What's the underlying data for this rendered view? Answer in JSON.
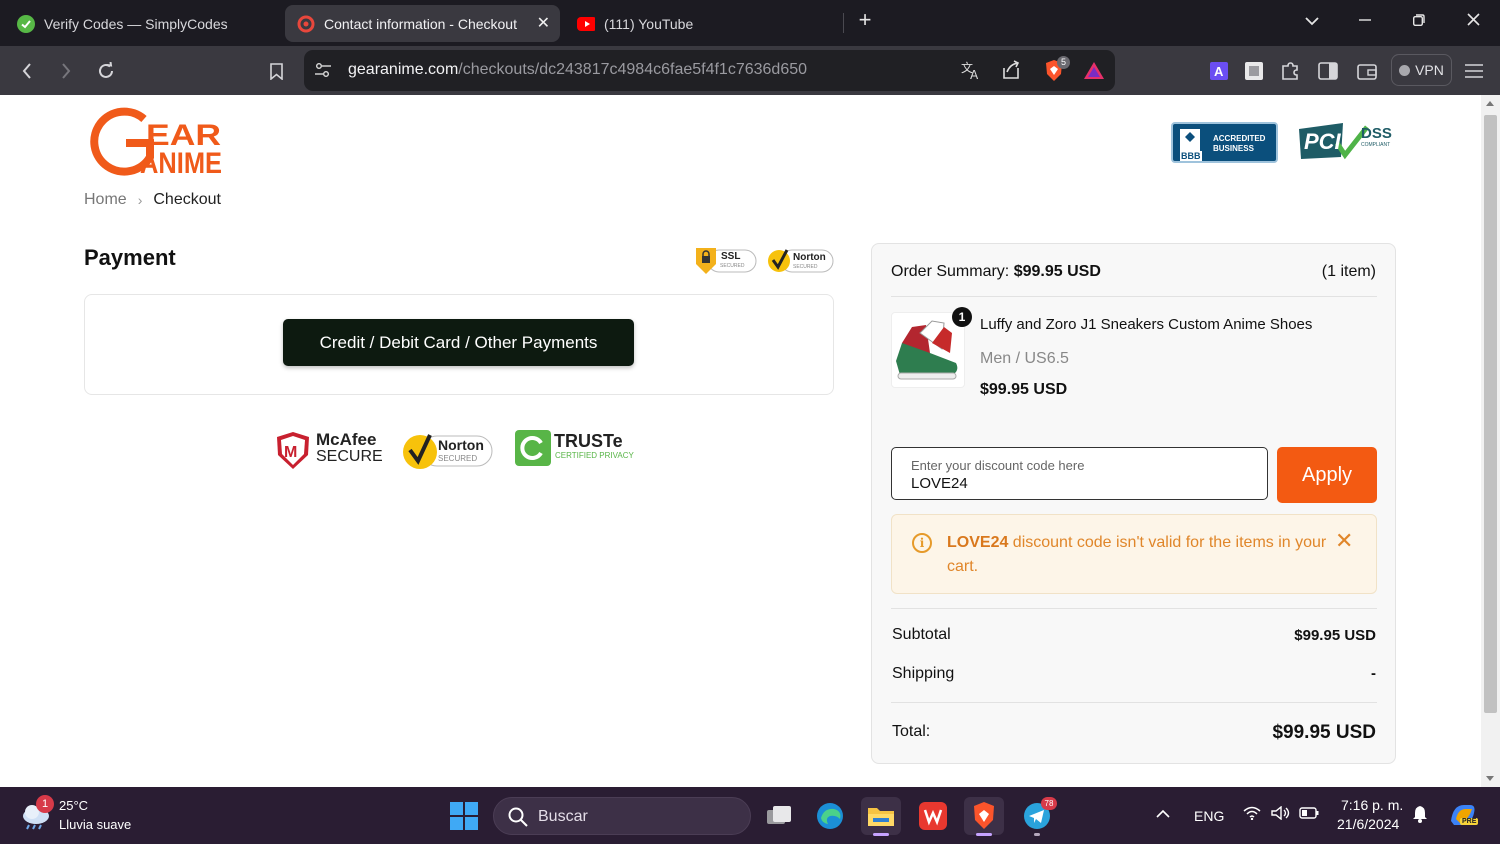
{
  "browser": {
    "tabs": [
      {
        "title": "Verify Codes — SimplyCodes",
        "active": false,
        "favicon": "simplycodes-check-icon"
      },
      {
        "title": "Contact information - Checkout",
        "active": true,
        "favicon": "gearanime-icon"
      },
      {
        "title": "(111) YouTube",
        "active": false,
        "favicon": "youtube-icon"
      }
    ],
    "url_host": "gearanime.com",
    "url_path": "/checkouts/dc243817c4984c6fae5f4f1c7636d650",
    "brave_shield_count": "5",
    "vpn_label": "VPN"
  },
  "page": {
    "logo_text": "GEAR ANIME",
    "breadcrumb": {
      "home": "Home",
      "current": "Checkout"
    },
    "bbb_lines": [
      "ACCREDITED",
      "BUSINESS"
    ],
    "bbb_short": "BBB",
    "pci_text": "PCI",
    "pci_dss": "DSS",
    "pci_compliant": "COMPLIANT",
    "payment_title": "Payment",
    "ssl_label": "SSL",
    "ssl_sub": "SECURED",
    "norton_label": "Norton",
    "norton_sub": "SECURED",
    "pay_button": "Credit / Debit Card / Other Payments",
    "trust": {
      "mcafee_top": "McAfee",
      "mcafee_bottom": "SECURE",
      "norton_top": "Norton",
      "norton_bottom": "SECURED",
      "truste_top": "TRUSTe",
      "truste_bottom": "CERTIFIED PRIVACY"
    }
  },
  "summary": {
    "title_label": "Order Summary:",
    "title_amount": "$99.95 USD",
    "item_count": "(1 item)",
    "product": {
      "quantity": "1",
      "name": "Luffy and Zoro J1 Sneakers Custom Anime Shoes",
      "variant": "Men / US6.5",
      "price": "$99.95 USD"
    },
    "discount": {
      "placeholder": "Enter your discount code here",
      "value": "LOVE24",
      "apply_label": "Apply"
    },
    "alert": {
      "code": "LOVE24",
      "message": " discount code isn't valid for the items in your cart."
    },
    "subtotal_label": "Subtotal",
    "subtotal_value": "$99.95 USD",
    "shipping_label": "Shipping",
    "shipping_value": "-",
    "total_label": "Total:",
    "total_value": "$99.95 USD"
  },
  "taskbar": {
    "weather_badge": "1",
    "temperature": "25°C",
    "weather_desc": "Lluvia suave",
    "search_placeholder": "Buscar",
    "telegram_badge": "78",
    "language": "ENG",
    "time": "7:16 p. m.",
    "date": "21/6/2024",
    "copilot_badge": "PRE"
  },
  "colors": {
    "brand_orange": "#f35a12",
    "pay_button_bg": "#0d1a10",
    "alert_text": "#e0862a",
    "alert_bg": "#fdf5e8",
    "bbb_blue": "#0b4f7c"
  }
}
